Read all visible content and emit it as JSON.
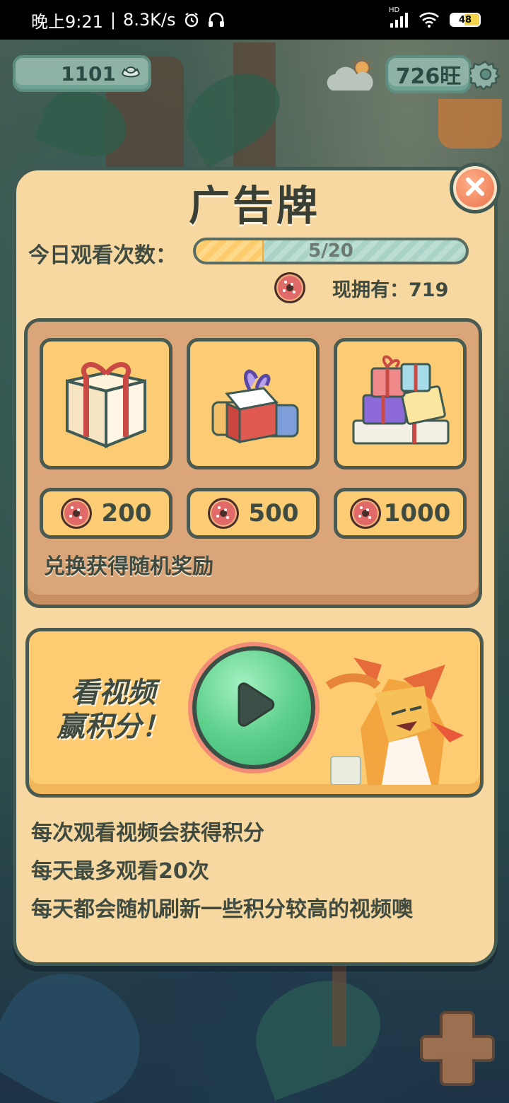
{
  "status_bar": {
    "time": "晚上9:21",
    "separator": "|",
    "net_speed": "8.3K/s",
    "battery": "48",
    "hd": "HD"
  },
  "hud": {
    "coins": "1101",
    "points": "726旺"
  },
  "panel": {
    "title": "广告牌",
    "watch_label": "今日观看次数：",
    "progress": {
      "current": 5,
      "total": 20,
      "text": "5/20"
    },
    "owned_label": "现拥有：719"
  },
  "exchange": {
    "options": [
      {
        "name": "single-gift",
        "price": "200"
      },
      {
        "name": "double-gift",
        "price": "500"
      },
      {
        "name": "gift-pile",
        "price": "1000"
      }
    ],
    "note": "兑换获得随机奖励"
  },
  "video": {
    "line1": "看视频",
    "line2": "赢积分！"
  },
  "info": [
    "每次观看视频会获得积分",
    "每天最多观看20次",
    "每天都会随机刷新一些积分较高的视频噢"
  ],
  "colors": {
    "panel_bg": "#f6d8a0",
    "panel_border": "#3f5a52",
    "card_bg": "#fbcc73",
    "exchange_bg": "#d9a579",
    "play_green": "#5fd08d",
    "close_orange": "#e9744a"
  },
  "icons": [
    "signal-icon",
    "wifi-icon",
    "alarm-icon",
    "headphones-icon",
    "battery-icon",
    "silver-ingot-icon",
    "weather-icon",
    "gear-icon",
    "close-icon",
    "donut-icon",
    "gift-icon",
    "play-icon",
    "dpad-icon"
  ]
}
